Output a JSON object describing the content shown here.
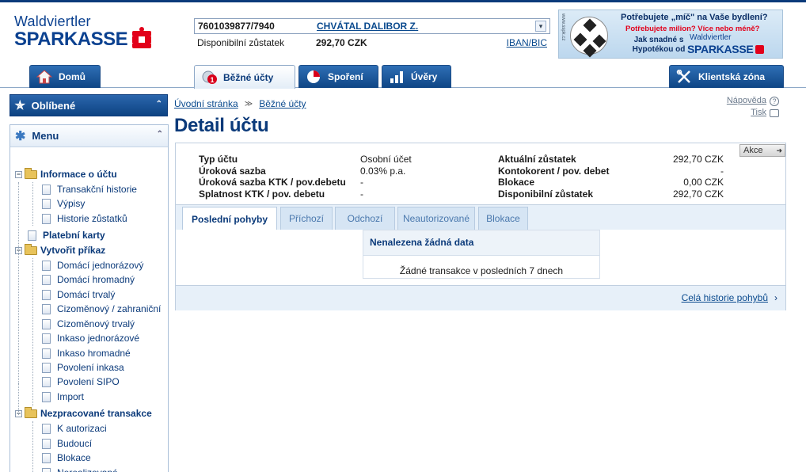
{
  "brand": {
    "line1": "Waldviertler",
    "line2": "SPARKASSE"
  },
  "account": {
    "number": "7601039877/7940",
    "owner": "CHVÁTAL DALIBOR Z.",
    "balance_label": "Disponibilní zůstatek",
    "balance_value": "292,70 CZK",
    "iban_link": "IBAN/BIC"
  },
  "banner": {
    "side_text": "www.sspk.cz",
    "headline": "Potřebujete „míč\" na Vaše bydlení?",
    "subline": "Potřebujete milion? Více nebo méně?",
    "body": "Jak snadné s Hypotékou od",
    "brand1": "Waldviertler",
    "brand2": "SPARKASSE"
  },
  "nav": {
    "home": "Domů",
    "current": "Běžné účty",
    "current_badge": "1",
    "savings": "Spoření",
    "loans": "Úvěry",
    "client_zone": "Klientská zóna"
  },
  "sidebar": {
    "favorites": "Oblíbené",
    "menu": "Menu",
    "items": [
      {
        "label": "Informace o účtu",
        "type": "folder"
      },
      {
        "label": "Transakční historie",
        "type": "page"
      },
      {
        "label": "Výpisy",
        "type": "page"
      },
      {
        "label": "Historie zůstatků",
        "type": "page"
      },
      {
        "label": "Platební karty",
        "type": "page-bold"
      },
      {
        "label": "Vytvořit příkaz",
        "type": "folder"
      },
      {
        "label": "Domácí jednorázový",
        "type": "page"
      },
      {
        "label": "Domácí hromadný",
        "type": "page"
      },
      {
        "label": "Domácí trvalý",
        "type": "page"
      },
      {
        "label": "Cizoměnový / zahraniční",
        "type": "page"
      },
      {
        "label": "Cizoměnový trvalý",
        "type": "page"
      },
      {
        "label": "Inkaso jednorázové",
        "type": "page"
      },
      {
        "label": "Inkaso hromadné",
        "type": "page"
      },
      {
        "label": "Povolení inkasa",
        "type": "page"
      },
      {
        "label": "Povolení SIPO",
        "type": "page"
      },
      {
        "label": "Import",
        "type": "page"
      },
      {
        "label": "Nezpracované transakce",
        "type": "folder"
      },
      {
        "label": "K autorizaci",
        "type": "page"
      },
      {
        "label": "Budoucí",
        "type": "page"
      },
      {
        "label": "Blokace",
        "type": "page"
      },
      {
        "label": "Nerealizované",
        "type": "page"
      }
    ]
  },
  "breadcrumb": {
    "home": "Úvodní stránka",
    "current": "Běžné účty"
  },
  "help": {
    "help": "Nápověda",
    "print": "Tisk"
  },
  "page_title": "Detail účtu",
  "actions_label": "Akce",
  "details": {
    "rows": [
      {
        "k1": "Typ účtu",
        "v1": "Osobní účet",
        "k2": "Aktuální zůstatek",
        "v2": "292,70 CZK"
      },
      {
        "k1": "Úroková sazba",
        "v1": "0.03% p.a.",
        "k2": "Kontokorent / pov. debet",
        "v2": "-"
      },
      {
        "k1": "Úroková sazba KTK / pov.debetu",
        "v1": "-",
        "k2": "Blokace",
        "v2": "0,00 CZK"
      },
      {
        "k1": "Splatnost KTK / pov. debetu",
        "v1": "-",
        "k2": "Disponibilní zůstatek",
        "v2": "292,70 CZK"
      }
    ]
  },
  "tabs": [
    {
      "label": "Poslední pohyby",
      "active": true
    },
    {
      "label": "Příchozí",
      "active": false
    },
    {
      "label": "Odchozí",
      "active": false
    },
    {
      "label": "Neautorizované",
      "active": false
    },
    {
      "label": "Blokace",
      "active": false
    }
  ],
  "empty": {
    "header": "Nenalezena žádná data",
    "message": "Žádné transakce v posledních 7 dnech"
  },
  "history_link": "Celá historie pohybů",
  "colors": {
    "primary": "#0b3a7a",
    "accent_red": "#e2001a",
    "tab_bg": "#e7f0f9"
  }
}
